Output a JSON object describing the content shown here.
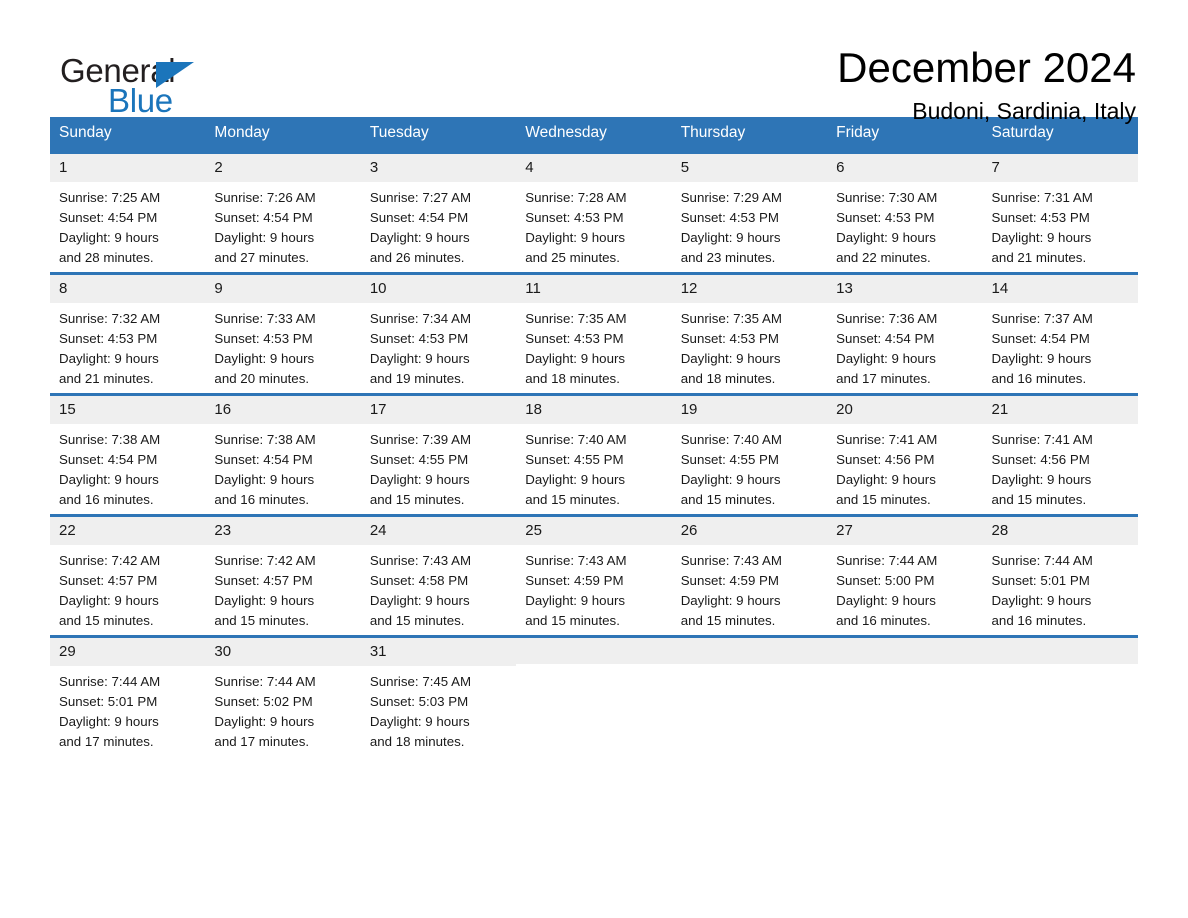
{
  "brand": {
    "name_part1": "General",
    "name_part2": "Blue",
    "accent_color": "#1b75bb"
  },
  "header": {
    "month_title": "December 2024",
    "location": "Budoni, Sardinia, Italy",
    "header_bg_color": "#2e75b6",
    "daynum_bg_color": "#efefef"
  },
  "weekdays": [
    "Sunday",
    "Monday",
    "Tuesday",
    "Wednesday",
    "Thursday",
    "Friday",
    "Saturday"
  ],
  "weeks": [
    [
      {
        "day": "1",
        "sunrise": "Sunrise: 7:25 AM",
        "sunset": "Sunset: 4:54 PM",
        "daylight_line1": "Daylight: 9 hours",
        "daylight_line2": "and 28 minutes."
      },
      {
        "day": "2",
        "sunrise": "Sunrise: 7:26 AM",
        "sunset": "Sunset: 4:54 PM",
        "daylight_line1": "Daylight: 9 hours",
        "daylight_line2": "and 27 minutes."
      },
      {
        "day": "3",
        "sunrise": "Sunrise: 7:27 AM",
        "sunset": "Sunset: 4:54 PM",
        "daylight_line1": "Daylight: 9 hours",
        "daylight_line2": "and 26 minutes."
      },
      {
        "day": "4",
        "sunrise": "Sunrise: 7:28 AM",
        "sunset": "Sunset: 4:53 PM",
        "daylight_line1": "Daylight: 9 hours",
        "daylight_line2": "and 25 minutes."
      },
      {
        "day": "5",
        "sunrise": "Sunrise: 7:29 AM",
        "sunset": "Sunset: 4:53 PM",
        "daylight_line1": "Daylight: 9 hours",
        "daylight_line2": "and 23 minutes."
      },
      {
        "day": "6",
        "sunrise": "Sunrise: 7:30 AM",
        "sunset": "Sunset: 4:53 PM",
        "daylight_line1": "Daylight: 9 hours",
        "daylight_line2": "and 22 minutes."
      },
      {
        "day": "7",
        "sunrise": "Sunrise: 7:31 AM",
        "sunset": "Sunset: 4:53 PM",
        "daylight_line1": "Daylight: 9 hours",
        "daylight_line2": "and 21 minutes."
      }
    ],
    [
      {
        "day": "8",
        "sunrise": "Sunrise: 7:32 AM",
        "sunset": "Sunset: 4:53 PM",
        "daylight_line1": "Daylight: 9 hours",
        "daylight_line2": "and 21 minutes."
      },
      {
        "day": "9",
        "sunrise": "Sunrise: 7:33 AM",
        "sunset": "Sunset: 4:53 PM",
        "daylight_line1": "Daylight: 9 hours",
        "daylight_line2": "and 20 minutes."
      },
      {
        "day": "10",
        "sunrise": "Sunrise: 7:34 AM",
        "sunset": "Sunset: 4:53 PM",
        "daylight_line1": "Daylight: 9 hours",
        "daylight_line2": "and 19 minutes."
      },
      {
        "day": "11",
        "sunrise": "Sunrise: 7:35 AM",
        "sunset": "Sunset: 4:53 PM",
        "daylight_line1": "Daylight: 9 hours",
        "daylight_line2": "and 18 minutes."
      },
      {
        "day": "12",
        "sunrise": "Sunrise: 7:35 AM",
        "sunset": "Sunset: 4:53 PM",
        "daylight_line1": "Daylight: 9 hours",
        "daylight_line2": "and 18 minutes."
      },
      {
        "day": "13",
        "sunrise": "Sunrise: 7:36 AM",
        "sunset": "Sunset: 4:54 PM",
        "daylight_line1": "Daylight: 9 hours",
        "daylight_line2": "and 17 minutes."
      },
      {
        "day": "14",
        "sunrise": "Sunrise: 7:37 AM",
        "sunset": "Sunset: 4:54 PM",
        "daylight_line1": "Daylight: 9 hours",
        "daylight_line2": "and 16 minutes."
      }
    ],
    [
      {
        "day": "15",
        "sunrise": "Sunrise: 7:38 AM",
        "sunset": "Sunset: 4:54 PM",
        "daylight_line1": "Daylight: 9 hours",
        "daylight_line2": "and 16 minutes."
      },
      {
        "day": "16",
        "sunrise": "Sunrise: 7:38 AM",
        "sunset": "Sunset: 4:54 PM",
        "daylight_line1": "Daylight: 9 hours",
        "daylight_line2": "and 16 minutes."
      },
      {
        "day": "17",
        "sunrise": "Sunrise: 7:39 AM",
        "sunset": "Sunset: 4:55 PM",
        "daylight_line1": "Daylight: 9 hours",
        "daylight_line2": "and 15 minutes."
      },
      {
        "day": "18",
        "sunrise": "Sunrise: 7:40 AM",
        "sunset": "Sunset: 4:55 PM",
        "daylight_line1": "Daylight: 9 hours",
        "daylight_line2": "and 15 minutes."
      },
      {
        "day": "19",
        "sunrise": "Sunrise: 7:40 AM",
        "sunset": "Sunset: 4:55 PM",
        "daylight_line1": "Daylight: 9 hours",
        "daylight_line2": "and 15 minutes."
      },
      {
        "day": "20",
        "sunrise": "Sunrise: 7:41 AM",
        "sunset": "Sunset: 4:56 PM",
        "daylight_line1": "Daylight: 9 hours",
        "daylight_line2": "and 15 minutes."
      },
      {
        "day": "21",
        "sunrise": "Sunrise: 7:41 AM",
        "sunset": "Sunset: 4:56 PM",
        "daylight_line1": "Daylight: 9 hours",
        "daylight_line2": "and 15 minutes."
      }
    ],
    [
      {
        "day": "22",
        "sunrise": "Sunrise: 7:42 AM",
        "sunset": "Sunset: 4:57 PM",
        "daylight_line1": "Daylight: 9 hours",
        "daylight_line2": "and 15 minutes."
      },
      {
        "day": "23",
        "sunrise": "Sunrise: 7:42 AM",
        "sunset": "Sunset: 4:57 PM",
        "daylight_line1": "Daylight: 9 hours",
        "daylight_line2": "and 15 minutes."
      },
      {
        "day": "24",
        "sunrise": "Sunrise: 7:43 AM",
        "sunset": "Sunset: 4:58 PM",
        "daylight_line1": "Daylight: 9 hours",
        "daylight_line2": "and 15 minutes."
      },
      {
        "day": "25",
        "sunrise": "Sunrise: 7:43 AM",
        "sunset": "Sunset: 4:59 PM",
        "daylight_line1": "Daylight: 9 hours",
        "daylight_line2": "and 15 minutes."
      },
      {
        "day": "26",
        "sunrise": "Sunrise: 7:43 AM",
        "sunset": "Sunset: 4:59 PM",
        "daylight_line1": "Daylight: 9 hours",
        "daylight_line2": "and 15 minutes."
      },
      {
        "day": "27",
        "sunrise": "Sunrise: 7:44 AM",
        "sunset": "Sunset: 5:00 PM",
        "daylight_line1": "Daylight: 9 hours",
        "daylight_line2": "and 16 minutes."
      },
      {
        "day": "28",
        "sunrise": "Sunrise: 7:44 AM",
        "sunset": "Sunset: 5:01 PM",
        "daylight_line1": "Daylight: 9 hours",
        "daylight_line2": "and 16 minutes."
      }
    ],
    [
      {
        "day": "29",
        "sunrise": "Sunrise: 7:44 AM",
        "sunset": "Sunset: 5:01 PM",
        "daylight_line1": "Daylight: 9 hours",
        "daylight_line2": "and 17 minutes."
      },
      {
        "day": "30",
        "sunrise": "Sunrise: 7:44 AM",
        "sunset": "Sunset: 5:02 PM",
        "daylight_line1": "Daylight: 9 hours",
        "daylight_line2": "and 17 minutes."
      },
      {
        "day": "31",
        "sunrise": "Sunrise: 7:45 AM",
        "sunset": "Sunset: 5:03 PM",
        "daylight_line1": "Daylight: 9 hours",
        "daylight_line2": "and 18 minutes."
      },
      {
        "day": "",
        "sunrise": "",
        "sunset": "",
        "daylight_line1": "",
        "daylight_line2": ""
      },
      {
        "day": "",
        "sunrise": "",
        "sunset": "",
        "daylight_line1": "",
        "daylight_line2": ""
      },
      {
        "day": "",
        "sunrise": "",
        "sunset": "",
        "daylight_line1": "",
        "daylight_line2": ""
      },
      {
        "day": "",
        "sunrise": "",
        "sunset": "",
        "daylight_line1": "",
        "daylight_line2": ""
      }
    ]
  ]
}
